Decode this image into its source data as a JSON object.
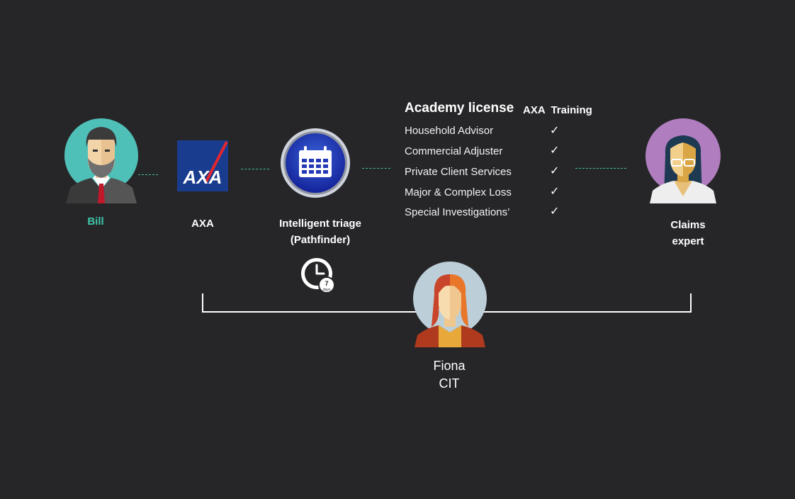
{
  "people": {
    "bill": {
      "name": "Bill",
      "color": "#3fc6a8"
    },
    "claims_expert": {
      "line1": "Claims",
      "line2": "expert"
    },
    "fiona": {
      "line1": "Fiona",
      "line2": "CIT"
    }
  },
  "axa": {
    "logo_text": "AXA",
    "label": "AXA",
    "brand_color": "#1a3c8f",
    "accent": "#e3262f"
  },
  "triage": {
    "line1": "Intelligent triage",
    "line2": "(Pathfinder)",
    "clock_badge": "7",
    "clock_badge_sub": "days"
  },
  "academy": {
    "title": "Academy license",
    "training_header": "AXA  Training",
    "rows": [
      {
        "label": "Household Advisor",
        "check": "✓"
      },
      {
        "label": "Commercial Adjuster",
        "check": "✓"
      },
      {
        "label": "Private Client Services",
        "check": "✓"
      },
      {
        "label": "Major & Complex Loss",
        "check": "✓"
      },
      {
        "label": "Special Investigations’",
        "check": "✓"
      }
    ]
  },
  "colors": {
    "background": "#262629",
    "connector": "#3fbf9e"
  }
}
